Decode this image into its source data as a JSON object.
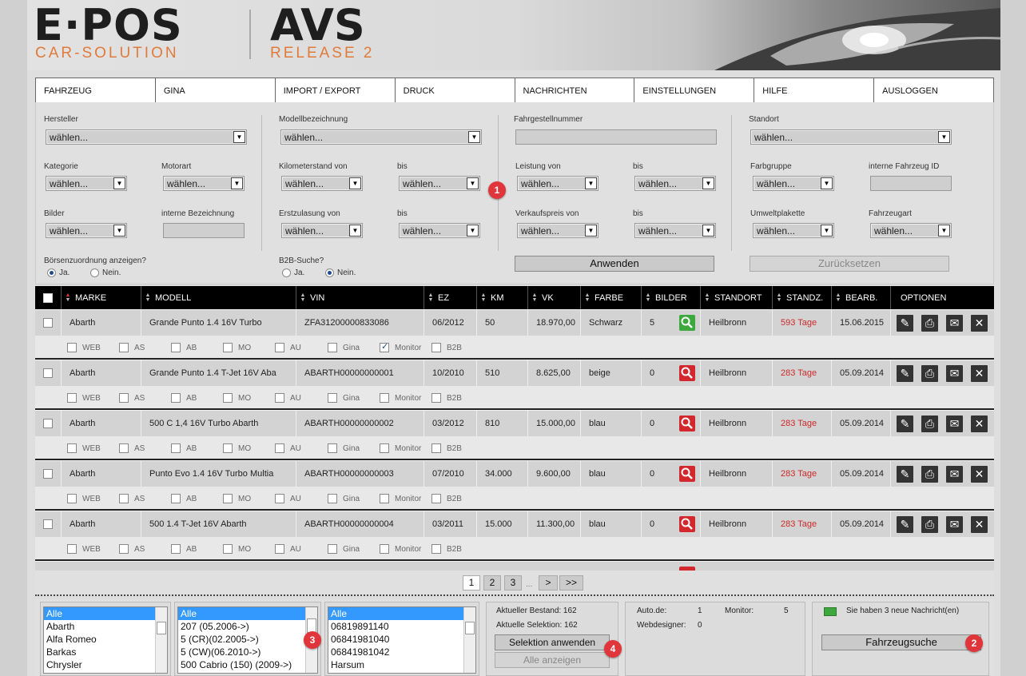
{
  "header": {
    "logo_main": "E·POS",
    "logo_sub": "CAR-SOLUTION",
    "product": "AVS",
    "release": "RELEASE 2"
  },
  "nav": [
    "FAHRZEUG",
    "GINA",
    "IMPORT / EXPORT",
    "DRUCK",
    "NACHRICHTEN",
    "EINSTELLUNGEN",
    "HILFE",
    "AUSLOGGEN"
  ],
  "filters": {
    "hersteller": {
      "label": "Hersteller",
      "value": "wählen..."
    },
    "modell": {
      "label": "Modellbezeichnung",
      "value": "wählen..."
    },
    "fgnr": {
      "label": "Fahrgestellnummer",
      "value": ""
    },
    "standort": {
      "label": "Standort",
      "value": "wählen..."
    },
    "kategorie": {
      "label": "Kategorie",
      "value": "wählen..."
    },
    "motorart": {
      "label": "Motorart",
      "value": "wählen..."
    },
    "km_von": {
      "label": "Kilometerstand von",
      "value": "wählen..."
    },
    "km_bis": {
      "label": "bis",
      "value": "wählen..."
    },
    "leistung_von": {
      "label": "Leistung von",
      "value": "wählen..."
    },
    "leistung_bis": {
      "label": "bis",
      "value": "wählen..."
    },
    "farbgruppe": {
      "label": "Farbgruppe",
      "value": "wählen..."
    },
    "interne_id": {
      "label": "interne Fahrzeug ID",
      "value": ""
    },
    "bilder": {
      "label": "Bilder",
      "value": "wählen..."
    },
    "interne_bez": {
      "label": "interne Bezeichnung",
      "value": ""
    },
    "ez_von": {
      "label": "Erstzulasung von",
      "value": "wählen..."
    },
    "ez_bis": {
      "label": "bis",
      "value": "wählen..."
    },
    "vk_von": {
      "label": "Verkaufspreis von",
      "value": "wählen..."
    },
    "vk_bis": {
      "label": "bis",
      "value": "wählen..."
    },
    "umwelt": {
      "label": "Umweltplakette",
      "value": "wählen..."
    },
    "fahrzeugart": {
      "label": "Fahrzeugart",
      "value": "wählen..."
    },
    "boerse": {
      "label": "Börsenzuordnung anzeigen?",
      "yes": "Ja.",
      "no": "Nein.",
      "selected": "yes"
    },
    "b2b": {
      "label": "B2B-Suche?",
      "yes": "Ja.",
      "no": "Nein.",
      "selected": "no"
    },
    "apply_label": "Anwenden",
    "reset_label": "Zurücksetzen"
  },
  "badges": [
    "1",
    "2",
    "3",
    "4"
  ],
  "table": {
    "columns": [
      "MARKE",
      "MODELL",
      "VIN",
      "EZ",
      "KM",
      "VK",
      "FARBE",
      "BILDER",
      "STANDORT",
      "STANDZ.",
      "BEARB.",
      "OPTIONEN"
    ],
    "flags": [
      "WEB",
      "AS",
      "AB",
      "MO",
      "AU",
      "Gina",
      "Monitor",
      "B2B"
    ],
    "rows": [
      {
        "marke": "Abarth",
        "modell": "Grande Punto 1.4 16V Turbo",
        "vin": "ZFA31200000833086",
        "ez": "06/2012",
        "km": "50",
        "vk": "18.970,00",
        "farbe": "Schwarz",
        "bilder": "5",
        "img_status": "green",
        "standort": "Heilbronn",
        "standz": "593 Tage",
        "bearb": "15.06.2015",
        "monitor": true
      },
      {
        "marke": "Abarth",
        "modell": "Grande Punto 1.4 T-Jet 16V Aba",
        "vin": "ABARTH00000000001",
        "ez": "10/2010",
        "km": "510",
        "vk": "8.625,00",
        "farbe": "beige",
        "bilder": "0",
        "img_status": "red",
        "standort": "Heilbronn",
        "standz": "283 Tage",
        "bearb": "05.09.2014",
        "monitor": false
      },
      {
        "marke": "Abarth",
        "modell": "500 C 1,4 16V Turbo Abarth",
        "vin": "ABARTH00000000002",
        "ez": "03/2012",
        "km": "810",
        "vk": "15.000,00",
        "farbe": "blau",
        "bilder": "0",
        "img_status": "red",
        "standort": "Heilbronn",
        "standz": "283 Tage",
        "bearb": "05.09.2014",
        "monitor": false
      },
      {
        "marke": "Abarth",
        "modell": "Punto Evo 1.4 16V Turbo Multia",
        "vin": "ABARTH00000000003",
        "ez": "07/2010",
        "km": "34.000",
        "vk": "9.600,00",
        "farbe": "blau",
        "bilder": "0",
        "img_status": "red",
        "standort": "Heilbronn",
        "standz": "283 Tage",
        "bearb": "05.09.2014",
        "monitor": false
      },
      {
        "marke": "Abarth",
        "modell": "500 1.4 T-Jet 16V Abarth",
        "vin": "ABARTH00000000004",
        "ez": "03/2011",
        "km": "15.000",
        "vk": "11.300,00",
        "farbe": "blau",
        "bilder": "0",
        "img_status": "red",
        "standort": "Heilbronn",
        "standz": "283 Tage",
        "bearb": "05.09.2014",
        "monitor": false
      }
    ]
  },
  "pager": {
    "pages": [
      "1",
      "2",
      "3"
    ],
    "ellipsis": "...",
    "next": ">",
    "last": ">>",
    "current": "1"
  },
  "bottom": {
    "brands": [
      "Alle",
      "Abarth",
      "Alfa Romeo",
      "Barkas",
      "Chrysler"
    ],
    "models": [
      "Alle",
      "207 (05.2006->)",
      "5 (CR)(02.2005->)",
      "5 (CW)(06.2010->)",
      "500 Cabrio (150) (2009->)"
    ],
    "locations": [
      "Alle",
      "06819891140",
      "06841981040",
      "06841981042",
      "Harsum"
    ],
    "bestand_label": "Aktueller Bestand: 162",
    "selektion_label": "Aktuelle Selektion: 162",
    "apply_selection": "Selektion anwenden",
    "show_all": "Alle anzeigen",
    "autode_label": "Auto.de:",
    "autode_value": "1",
    "monitor_label": "Monitor:",
    "monitor_value": "5",
    "webdesigner_label": "Webdesigner:",
    "webdesigner_value": "0",
    "messages": "Sie haben 3 neue Nachricht(en)",
    "search_button": "Fahrzeugsuche"
  }
}
